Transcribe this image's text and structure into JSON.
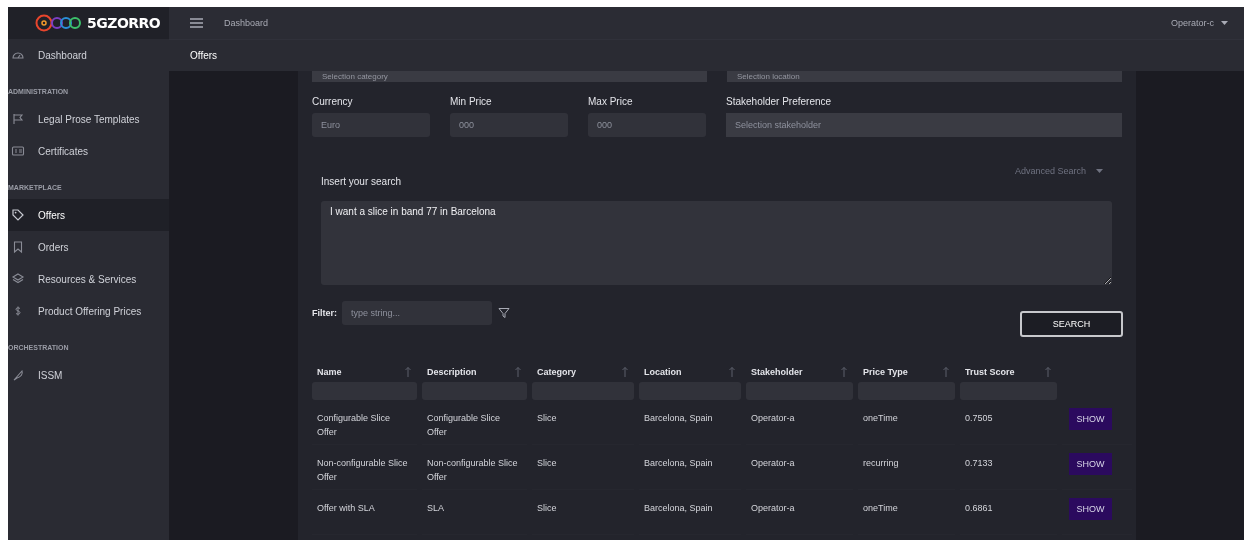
{
  "header": {
    "logo": "5GZORRO",
    "breadcrumb": "Dashboard",
    "user": "Operator-c"
  },
  "sidebar": {
    "items": [
      {
        "kind": "item",
        "label": "Dashboard",
        "selected": false
      },
      {
        "kind": "section",
        "label": "ADMINISTRATION"
      },
      {
        "kind": "item",
        "label": "Legal Prose Templates",
        "selected": false
      },
      {
        "kind": "item",
        "label": "Certificates",
        "selected": false
      },
      {
        "kind": "section",
        "label": "MARKETPLACE"
      },
      {
        "kind": "item",
        "label": "Offers",
        "selected": true
      },
      {
        "kind": "item",
        "label": "Orders",
        "selected": false
      },
      {
        "kind": "item",
        "label": "Resources & Services",
        "selected": false
      },
      {
        "kind": "item",
        "label": "Product Offering Prices",
        "selected": false
      },
      {
        "kind": "section",
        "label": "ORCHESTRATION"
      },
      {
        "kind": "item",
        "label": "ISSM",
        "selected": false
      }
    ]
  },
  "page_title": "Offers",
  "form": {
    "top_fields": [
      {
        "placeholder": "Selection category"
      },
      {
        "placeholder": "Selection location"
      }
    ],
    "fields": [
      {
        "label": "Currency",
        "placeholder": "Euro"
      },
      {
        "label": "Min Price",
        "placeholder": "000"
      },
      {
        "label": "Max Price",
        "placeholder": "000"
      },
      {
        "label": "Stakeholder Preference",
        "placeholder": "Selection stakeholder"
      }
    ],
    "advanced_search": "Advanced Search",
    "search_label": "Insert your search",
    "search_value": "I want a slice in band 77 in Barcelona",
    "filter_label": "Filter:",
    "filter_placeholder": "type string...",
    "search_button": "SEARCH"
  },
  "table": {
    "columns": [
      "Name",
      "Description",
      "Category",
      "Location",
      "Stakeholder",
      "Price Type",
      "Trust Score"
    ],
    "rows": [
      {
        "cells": [
          "Configurable Slice Offer",
          "Configurable Slice Offer",
          "Slice",
          "Barcelona, Spain",
          "Operator-a",
          "oneTime",
          "0.7505"
        ],
        "action": "SHOW"
      },
      {
        "cells": [
          "Non-configurable Slice Offer",
          "Non-configurable Slice Offer",
          "Slice",
          "Barcelona, Spain",
          "Operator-a",
          "recurring",
          "0.7133"
        ],
        "action": "SHOW"
      },
      {
        "cells": [
          "Offer with SLA",
          "SLA",
          "Slice",
          "Barcelona, Spain",
          "Operator-a",
          "oneTime",
          "0.6861"
        ],
        "action": "SHOW"
      }
    ]
  }
}
